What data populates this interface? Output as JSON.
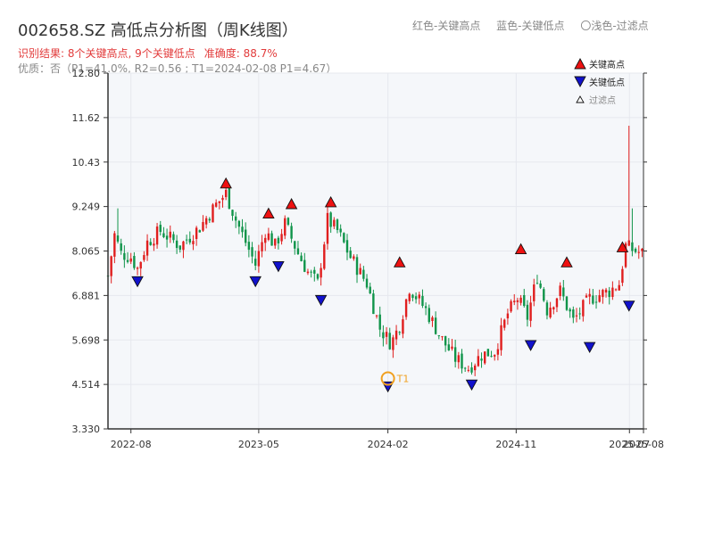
{
  "header": {
    "title": "002658.SZ 高低点分析图（周K线图）",
    "legend_red": "红色-关键高点",
    "legend_blue": "蓝色-关键低点",
    "legend_light": "〇浅色-过滤点",
    "result": "识别结果: 8个关键高点, 9个关键低点",
    "accuracy": "准确度: 88.7%",
    "quality": "优质：否（P1=41.0%, R2=0.56 ; T1=2024-02-08 P1=4.67）"
  },
  "colors": {
    "up": "#e01e1e",
    "down": "#10944a",
    "high_marker": "#ee1111",
    "low_marker": "#1111cc",
    "t1": "#f0a020",
    "axis": "#333333",
    "grid": "#e6e8ee",
    "plot_bg": "#f5f7fa"
  },
  "chart_data": {
    "type": "candlestick",
    "ylim": [
      3.33,
      12.8
    ],
    "yticks": [
      "3.330",
      "4.514",
      "5.698",
      "6.881",
      "8.065",
      "9.249",
      "10.43",
      "11.62",
      "12.80"
    ],
    "x_range": [
      "2022-06-13",
      "2025-07-31"
    ],
    "xticks": [
      {
        "date": "2022-08-01",
        "label": "2022-08"
      },
      {
        "date": "2023-05-01",
        "label": "2023-05"
      },
      {
        "date": "2024-02-01",
        "label": "2024-02"
      },
      {
        "date": "2024-11-01",
        "label": "2024-11"
      },
      {
        "date": "2025-07-01",
        "label": "2025-07"
      },
      {
        "date": "2025-07-31",
        "label": "2025-08"
      }
    ],
    "legend": [
      {
        "marker": "high",
        "label": "关键高点"
      },
      {
        "marker": "low",
        "label": "关键低点"
      },
      {
        "marker": "filtered",
        "label": "过滤点"
      }
    ],
    "close_anchors": [
      [
        "2022-06-13",
        7.4
      ],
      [
        "2022-06-27",
        8.5
      ],
      [
        "2022-07-11",
        8.0
      ],
      [
        "2022-08-01",
        7.9
      ],
      [
        "2022-08-15",
        7.6
      ],
      [
        "2022-09-05",
        8.3
      ],
      [
        "2022-10-03",
        8.6
      ],
      [
        "2022-11-14",
        8.2
      ],
      [
        "2022-12-26",
        8.7
      ],
      [
        "2023-01-30",
        9.3
      ],
      [
        "2023-02-20",
        9.6
      ],
      [
        "2023-03-13",
        8.9
      ],
      [
        "2023-04-10",
        8.1
      ],
      [
        "2023-04-24",
        7.7
      ],
      [
        "2023-05-15",
        8.6
      ],
      [
        "2023-06-05",
        8.2
      ],
      [
        "2023-06-26",
        8.8
      ],
      [
        "2023-07-24",
        8.0
      ],
      [
        "2023-08-14",
        7.5
      ],
      [
        "2023-09-04",
        7.2
      ],
      [
        "2023-09-25",
        8.9
      ],
      [
        "2023-10-16",
        8.6
      ],
      [
        "2023-11-13",
        7.9
      ],
      [
        "2023-12-18",
        7.2
      ],
      [
        "2024-01-15",
        6.0
      ],
      [
        "2024-02-08",
        5.6
      ],
      [
        "2024-02-26",
        6.1
      ],
      [
        "2024-03-18",
        7.1
      ],
      [
        "2024-04-22",
        6.5
      ],
      [
        "2024-05-27",
        5.7
      ],
      [
        "2024-06-24",
        5.2
      ],
      [
        "2024-07-22",
        4.95
      ],
      [
        "2024-08-19",
        5.3
      ],
      [
        "2024-09-16",
        5.4
      ],
      [
        "2024-10-14",
        6.4
      ],
      [
        "2024-11-04",
        6.8
      ],
      [
        "2024-11-25",
        6.3
      ],
      [
        "2024-12-16",
        7.4
      ],
      [
        "2025-01-06",
        6.5
      ],
      [
        "2025-02-03",
        7.0
      ],
      [
        "2025-03-03",
        6.2
      ],
      [
        "2025-04-07",
        6.8
      ],
      [
        "2025-05-19",
        7.0
      ],
      [
        "2025-06-09",
        7.2
      ],
      [
        "2025-06-23",
        8.2
      ],
      [
        "2025-07-07",
        8.1
      ],
      [
        "2025-07-28",
        8.0
      ]
    ],
    "spikes": [
      {
        "date": "2022-07-04",
        "high": 9.2
      },
      {
        "date": "2025-06-30",
        "high": 11.4
      },
      {
        "date": "2025-07-07",
        "high": 9.2
      }
    ],
    "high_points": [
      {
        "date": "2023-02-20",
        "value": 9.6
      },
      {
        "date": "2023-05-22",
        "value": 8.8
      },
      {
        "date": "2023-07-10",
        "value": 9.05
      },
      {
        "date": "2023-10-02",
        "value": 9.1
      },
      {
        "date": "2024-02-26",
        "value": 7.5
      },
      {
        "date": "2024-11-11",
        "value": 7.85
      },
      {
        "date": "2025-02-17",
        "value": 7.5
      },
      {
        "date": "2025-06-16",
        "value": 7.9
      }
    ],
    "low_points": [
      {
        "date": "2022-08-15",
        "value": 7.5
      },
      {
        "date": "2023-04-24",
        "value": 7.5
      },
      {
        "date": "2023-06-12",
        "value": 7.9
      },
      {
        "date": "2023-09-11",
        "value": 7.0
      },
      {
        "date": "2024-02-01",
        "value": 4.7
      },
      {
        "date": "2024-07-29",
        "value": 4.75
      },
      {
        "date": "2024-12-02",
        "value": 5.8
      },
      {
        "date": "2025-04-07",
        "value": 5.75
      },
      {
        "date": "2025-06-30",
        "value": 6.85
      }
    ],
    "t1": {
      "date": "2024-02-01",
      "value": 4.67,
      "label": "T1"
    }
  }
}
